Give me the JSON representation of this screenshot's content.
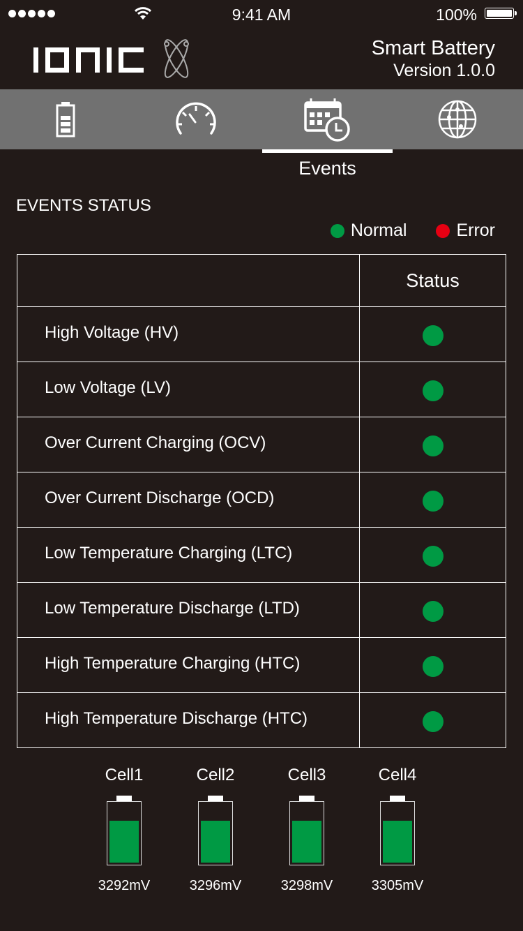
{
  "status_bar": {
    "signal_icon": "signal-dots-icon",
    "wifi_icon": "wifi-icon",
    "time": "9:41 AM",
    "battery_percent": "100%",
    "battery_icon": "battery-full-icon"
  },
  "header": {
    "logo_text": "IONIC",
    "logo_icon": "atom-orbit-icon",
    "app_title": "Smart Battery",
    "version": "Version 1.0.0"
  },
  "tabs": [
    {
      "icon": "battery-icon",
      "label": "Battery",
      "active": false
    },
    {
      "icon": "speedometer-icon",
      "label": "Speed",
      "active": false
    },
    {
      "icon": "calendar-clock-icon",
      "label": "Events",
      "active": true
    },
    {
      "icon": "globe-icon",
      "label": "Global",
      "active": false
    }
  ],
  "active_tab_label": "Events",
  "events": {
    "title": "EVENTS STATUS",
    "legend": [
      {
        "label": "Normal",
        "color": "#009a44"
      },
      {
        "label": "Error",
        "color": "#e60012"
      }
    ],
    "table_header": {
      "name": "",
      "status": "Status"
    },
    "rows": [
      {
        "name": "High Voltage (HV)",
        "status": "Normal"
      },
      {
        "name": "Low Voltage (LV)",
        "status": "Normal"
      },
      {
        "name": "Over Current Charging (OCV)",
        "status": "Normal"
      },
      {
        "name": "Over Current Discharge (OCD)",
        "status": "Normal"
      },
      {
        "name": "Low Temperature Charging (LTC)",
        "status": "Normal"
      },
      {
        "name": "Low Temperature Discharge (LTD)",
        "status": "Normal"
      },
      {
        "name": "High Temperature Charging (HTC)",
        "status": "Normal"
      },
      {
        "name": "High Temperature Discharge (HTC)",
        "status": "Normal"
      }
    ]
  },
  "cells": [
    {
      "label": "Cell1",
      "value": "3292mV",
      "fill_fraction": 0.72
    },
    {
      "label": "Cell2",
      "value": "3296mV",
      "fill_fraction": 0.72
    },
    {
      "label": "Cell3",
      "value": "3298mV",
      "fill_fraction": 0.72
    },
    {
      "label": "Cell4",
      "value": "3305mV",
      "fill_fraction": 0.72
    }
  ],
  "colors": {
    "background": "#221a18",
    "tabbar": "#717171",
    "normal": "#009a44",
    "error": "#e60012"
  }
}
